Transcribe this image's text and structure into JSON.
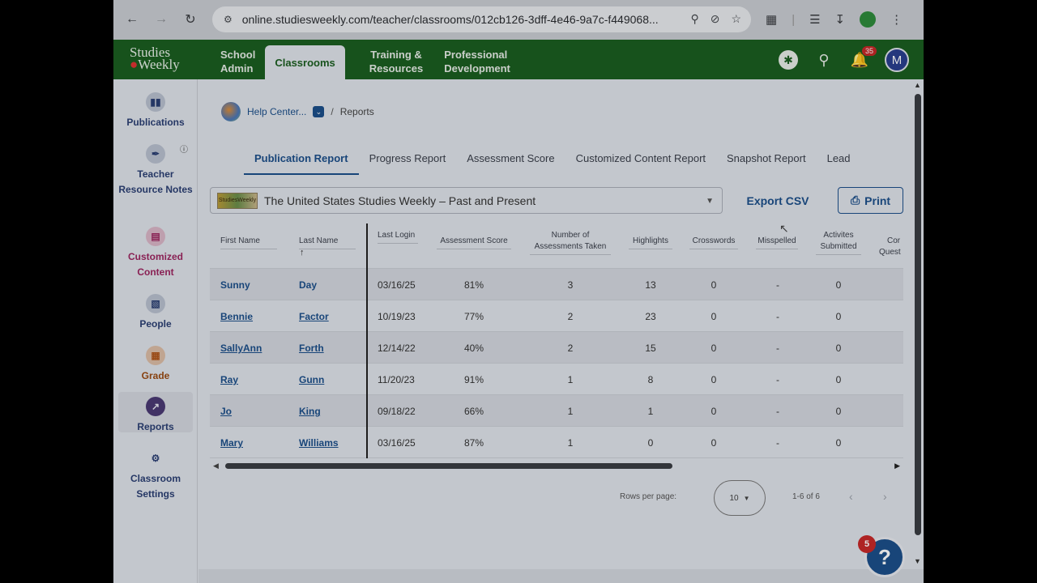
{
  "browser": {
    "url": "online.studiesweekly.com/teacher/classrooms/012cb126-3dff-4e46-9a7c-f449068..."
  },
  "header": {
    "logo_line1": "Studies",
    "logo_line2": "Weekly",
    "nav": [
      {
        "label": "School\nAdmin"
      },
      {
        "label": "Classrooms"
      },
      {
        "label": "Training &\nResources"
      },
      {
        "label": "Professional\nDevelopment"
      }
    ],
    "notification_count": "35",
    "avatar_letter": "M"
  },
  "sidebar": {
    "items": [
      {
        "label": "Publications"
      },
      {
        "label": "Teacher Resource Notes"
      },
      {
        "label": "Customized Content"
      },
      {
        "label": "People"
      },
      {
        "label": "Grade"
      },
      {
        "label": "Reports"
      },
      {
        "label": "Classroom Settings"
      }
    ]
  },
  "breadcrumb": {
    "parent": "Help Center...",
    "current": "Reports",
    "separator": "/"
  },
  "tabs": [
    {
      "label": "Publication Report"
    },
    {
      "label": "Progress Report"
    },
    {
      "label": "Assessment Score"
    },
    {
      "label": "Customized Content Report"
    },
    {
      "label": "Snapshot Report"
    },
    {
      "label": "Lead"
    }
  ],
  "publication": {
    "thumb_text": "StudiesWeekly",
    "selected": "The United States Studies Weekly – Past and Present"
  },
  "actions": {
    "export": "Export CSV",
    "print": "Print"
  },
  "table": {
    "headers": {
      "first_name": "First Name",
      "last_name": "Last Name",
      "last_login": "Last Login",
      "assessment_score": "Assessment Score",
      "assessments_taken_1": "Number of",
      "assessments_taken_2": "Assessments Taken",
      "highlights": "Highlights",
      "crosswords": "Crosswords",
      "misspelled": "Misspelled",
      "activities_1": "Activites",
      "activities_2": "Submitted",
      "cut_1": "Cor",
      "cut_2": "Quest"
    },
    "rows": [
      {
        "first": "Sunny",
        "last": "Day",
        "login": "03/16/25",
        "score": "81%",
        "taken": "3",
        "highlights": "13",
        "crosswords": "0",
        "misspelled": "-",
        "activities": "0"
      },
      {
        "first": "Bennie",
        "last": "Factor",
        "login": "10/19/23",
        "score": "77%",
        "taken": "2",
        "highlights": "23",
        "crosswords": "0",
        "misspelled": "-",
        "activities": "0"
      },
      {
        "first": "SallyAnn",
        "last": "Forth",
        "login": "12/14/22",
        "score": "40%",
        "taken": "2",
        "highlights": "15",
        "crosswords": "0",
        "misspelled": "-",
        "activities": "0"
      },
      {
        "first": "Ray",
        "last": "Gunn",
        "login": "11/20/23",
        "score": "91%",
        "taken": "1",
        "highlights": "8",
        "crosswords": "0",
        "misspelled": "-",
        "activities": "0"
      },
      {
        "first": "Jo",
        "last": "King",
        "login": "09/18/22",
        "score": "66%",
        "taken": "1",
        "highlights": "1",
        "crosswords": "0",
        "misspelled": "-",
        "activities": "0"
      },
      {
        "first": "Mary",
        "last": "Williams",
        "login": "03/16/25",
        "score": "87%",
        "taken": "1",
        "highlights": "0",
        "crosswords": "0",
        "misspelled": "-",
        "activities": "0"
      }
    ]
  },
  "pagination": {
    "rows_label": "Rows per page:",
    "rows_value": "10",
    "range": "1-6 of 6"
  },
  "help": {
    "badge": "5",
    "glyph": "?"
  },
  "colors": {
    "brand_green": "#1b5e20",
    "link_blue": "#1c4f8a",
    "badge_red": "#c62828"
  }
}
